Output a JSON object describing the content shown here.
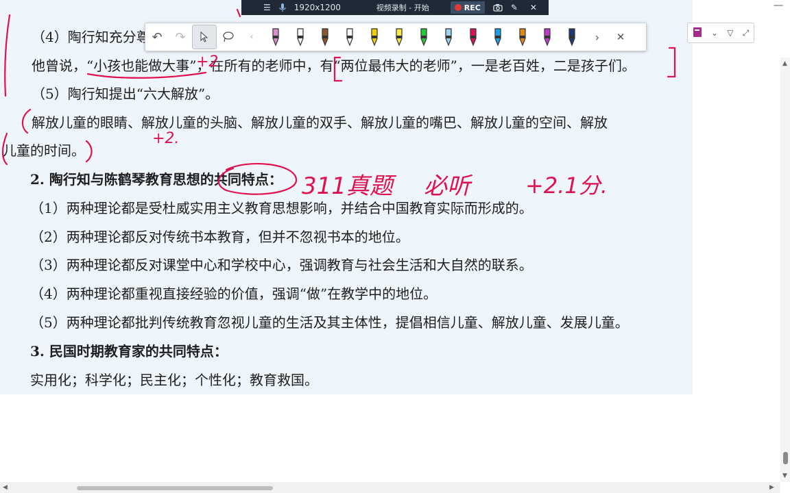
{
  "recorder": {
    "menu_icon": "hamburger-icon",
    "mic_icon": "microphone-icon",
    "resolution": "1920x1200",
    "title": "视频录制 - 开始",
    "rec_label": "REC",
    "camera_icon": "camera-icon",
    "pen_icon": "pen-icon",
    "close_icon": "close-icon"
  },
  "toolbar": {
    "tools": [
      "undo-icon",
      "redo-icon",
      "cursor-icon",
      "lasso-icon",
      "chevron-left-icon"
    ],
    "pens": [
      {
        "name": "pen-pink",
        "color": "#d98fd0"
      },
      {
        "name": "pen-outline",
        "color": "#ffffff"
      },
      {
        "name": "pen-brown",
        "color": "#8b5a2b"
      },
      {
        "name": "pen-white",
        "color": "#ffffff"
      },
      {
        "name": "pen-yellow",
        "color": "#f5d000"
      },
      {
        "name": "highlighter-yellow",
        "color": "#ffe94d"
      },
      {
        "name": "highlighter-green",
        "color": "#28c83c"
      },
      {
        "name": "highlighter-blue",
        "color": "#9fd3f5"
      },
      {
        "name": "pen-red",
        "color": "#e0114f"
      },
      {
        "name": "pen-cyan",
        "color": "#1ea0e8"
      },
      {
        "name": "pen-rainbow",
        "color": "#e08a1e"
      },
      {
        "name": "pen-magenta",
        "color": "#c03cc8"
      },
      {
        "name": "pen-navy",
        "color": "#1e3a78"
      }
    ],
    "more_icon": "chevron-right-icon",
    "close_icon": "close-icon"
  },
  "mini_toolbar": {
    "notebook_icon": "notebook-icon",
    "dropdown_icon": "chevron-down-icon",
    "filter_icon": "filter-icon",
    "expand_icon": "expand-icon"
  },
  "document": {
    "lines": [
      {
        "text": "（4）陶行知充分尊",
        "bold": false
      },
      {
        "text": "他曾说，“小孩也能做大事”，在所有的老师中，有“两位最伟大的老师”，一是老百姓，二是孩子们。",
        "bold": false
      },
      {
        "text": "（5）陶行知提出“六大解放”。",
        "bold": false
      },
      {
        "text": "解放儿童的眼睛、解放儿童的头脑、解放儿童的双手、解放儿童的嘴巴、解放儿童的空间、解放",
        "bold": false
      },
      {
        "text": "儿童的时间。",
        "bold": false
      },
      {
        "text": "2. 陶行知与陈鹤琴教育思想的共同特点：",
        "bold": true
      },
      {
        "text": "（1）两种理论都是受杜威实用主义教育思想影响，并结合中国教育实际而形成的。",
        "bold": false
      },
      {
        "text": "（2）两种理论都反对传统书本教育，但并不忽视书本的地位。",
        "bold": false
      },
      {
        "text": "（3）两种理论都反对课堂中心和学校中心，强调教育与社会生活和大自然的联系。",
        "bold": false
      },
      {
        "text": "（4）两种理论都重视直接经验的价值，强调“做”在教学中的地位。",
        "bold": false
      },
      {
        "text": "（5）两种理论都批判传统教育忽视儿童的生活及其主体性，提倡相信儿童、解放儿童、发展儿童。",
        "bold": false
      },
      {
        "text": "3. 民国时期教育家的共同特点：",
        "bold": true
      },
      {
        "text": "实用化；科学化；民主化；个性化；教育救国。",
        "bold": false
      }
    ]
  },
  "annotations": {
    "plus2_a": "+2",
    "plus2_b": "+2.",
    "note_questions": "311真题",
    "note_listen": "必听",
    "note_score": "+2.1分."
  },
  "colors": {
    "ink": "#e0114f",
    "doc_bg": "#eef5fb",
    "recorder_bg": "#1f2a36"
  }
}
